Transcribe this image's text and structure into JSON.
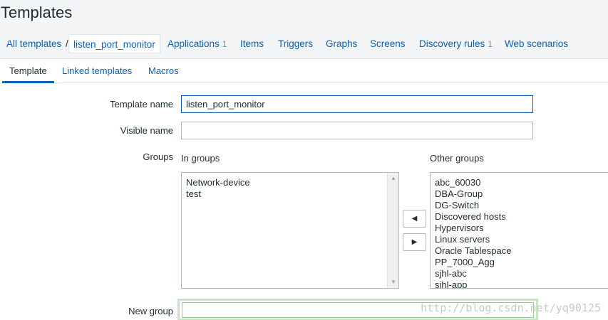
{
  "page_title": "Templates",
  "breadcrumb": {
    "all_templates": "All templates",
    "separator": "/",
    "current": "listen_port_monitor"
  },
  "nav": {
    "applications": {
      "label": "Applications",
      "count": "1"
    },
    "items": {
      "label": "Items"
    },
    "triggers": {
      "label": "Triggers"
    },
    "graphs": {
      "label": "Graphs"
    },
    "screens": {
      "label": "Screens"
    },
    "discovery_rules": {
      "label": "Discovery rules",
      "count": "1"
    },
    "web_scenarios": {
      "label": "Web scenarios"
    }
  },
  "tabs": {
    "template": "Template",
    "linked_templates": "Linked templates",
    "macros": "Macros"
  },
  "form": {
    "template_name": {
      "label": "Template name",
      "value": "listen_port_monitor"
    },
    "visible_name": {
      "label": "Visible name",
      "value": ""
    },
    "groups": {
      "label": "Groups",
      "in_groups_label": "In groups",
      "other_groups_label": "Other groups",
      "in_groups": [
        "Network-device",
        "test"
      ],
      "other_groups": [
        "abc_60030",
        "DBA-Group",
        "DG-Switch",
        "Discovered hosts",
        "Hypervisors",
        "Linux servers",
        "Oracle Tablespace",
        "PP_7000_Agg",
        "sjhl-abc",
        "sjhl-app"
      ],
      "move_left": "◀",
      "move_right": "▶"
    },
    "new_group": {
      "label": "New group",
      "value": ""
    }
  },
  "watermark": "http://blog.csdn.net/yq90125",
  "colors": {
    "link": "#0b62b5",
    "text": "#1f2c33",
    "border": "#acbbc2",
    "focus": "#0b62b5",
    "new_group_highlight": "#c8e3c5"
  }
}
